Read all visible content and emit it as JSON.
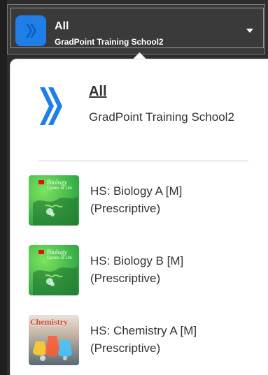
{
  "topbar": {
    "title": "All",
    "subtitle": "GradPoint Training School2",
    "logo_icon": "chevrons-right-icon",
    "dropdown_icon": "caret-down-icon"
  },
  "menu": {
    "org": {
      "title": "All",
      "subtitle": "GradPoint Training School2",
      "logo_icon": "chevrons-right-icon"
    },
    "courses": [
      {
        "label": "HS: Biology A [M] (Prescriptive)",
        "thumb_title": "Biology",
        "thumb_subtitle": "Cycles of Life"
      },
      {
        "label": "HS: Biology B [M] (Prescriptive)",
        "thumb_title": "Biology",
        "thumb_subtitle": "Cycles of Life"
      },
      {
        "label": "HS: Chemistry A [M] (Prescriptive)",
        "thumb_title": "Chemistry",
        "thumb_subtitle": ""
      }
    ]
  },
  "colors": {
    "brand_blue": "#1f7fe6",
    "menu_bg": "#ffffff",
    "text": "#333333",
    "bar_bg": "#3a3a3a"
  }
}
